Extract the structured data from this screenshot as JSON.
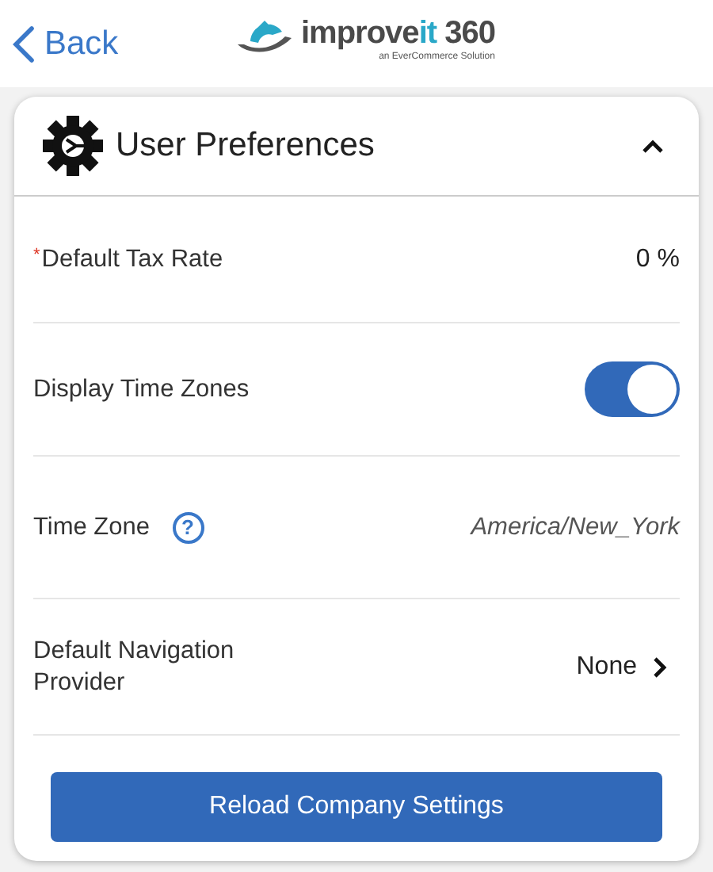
{
  "nav": {
    "back": "Back",
    "logo": {
      "word": "improve",
      "accent": "it",
      "number": "360",
      "tagline": "an EverCommerce Solution"
    }
  },
  "section": {
    "title": "User Preferences",
    "expanded": true,
    "rows": [
      {
        "kind": "value",
        "label": "Default Tax Rate",
        "required": true,
        "required_mark": "*",
        "value": "0 %"
      },
      {
        "kind": "toggle",
        "label": "Display Time Zones",
        "on": true
      },
      {
        "kind": "help",
        "label": "Time Zone",
        "help": "?",
        "value": "America/New_York"
      },
      {
        "kind": "select",
        "label": "Default Navigation Provider",
        "value": "None"
      }
    ],
    "button": "Reload Company Settings"
  }
}
